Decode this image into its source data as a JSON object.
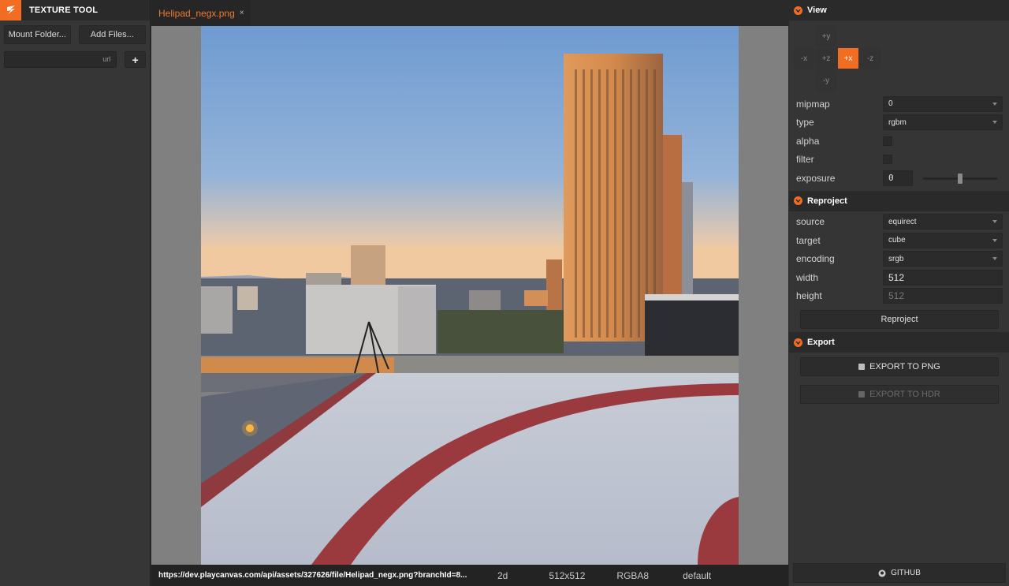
{
  "app": {
    "title": "TEXTURE TOOL"
  },
  "left": {
    "mount_folder_label": "Mount Folder...",
    "add_files_label": "Add Files...",
    "url_placeholder": "url",
    "add_url_label": "+"
  },
  "tab": {
    "label": "Helipad_negx.png",
    "close": "×"
  },
  "status": {
    "url": "https://dev.playcanvas.com/api/assets/327626/file/Helipad_negx.png?branchId=8...",
    "dimension": "2d",
    "size": "512x512",
    "format": "RGBA8",
    "encoding": "default"
  },
  "view": {
    "title": "View",
    "faces": {
      "py": "+y",
      "nx": "-x",
      "pz": "+z",
      "px": "+x",
      "nz": "-z",
      "ny": "-y"
    },
    "active_face": "+x",
    "mipmap_label": "mipmap",
    "mipmap_value": "0",
    "type_label": "type",
    "type_value": "rgbm",
    "alpha_label": "alpha",
    "filter_label": "filter",
    "exposure_label": "exposure",
    "exposure_value": "0",
    "exposure_slider_fraction": 0.5
  },
  "reproject": {
    "title": "Reproject",
    "source_label": "source",
    "source_value": "equirect",
    "target_label": "target",
    "target_value": "cube",
    "encoding_label": "encoding",
    "encoding_value": "srgb",
    "width_label": "width",
    "width_value": "512",
    "height_label": "height",
    "height_value": "512",
    "button_label": "Reproject"
  },
  "export": {
    "title": "Export",
    "png_label": "EXPORT TO PNG",
    "hdr_label": "EXPORT TO HDR"
  },
  "github_label": "GITHUB",
  "colors": {
    "accent": "#f26d21",
    "panel": "#353535",
    "header": "#2a2a2a"
  }
}
